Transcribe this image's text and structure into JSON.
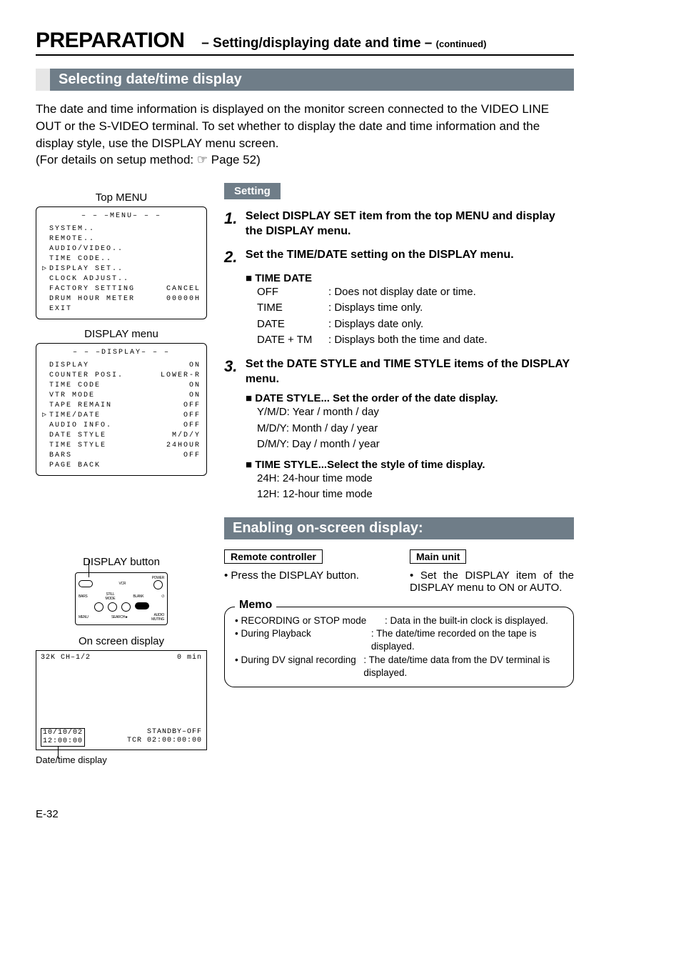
{
  "header": {
    "title": "PREPARATION",
    "subtitle": "– Setting/displaying date and time –",
    "continued": "(continued)"
  },
  "section1": {
    "title": "Selecting date/time display",
    "intro": "The date and time information is displayed on the monitor screen connected to the VIDEO LINE OUT or the S-VIDEO terminal. To set whether to display the date and time information and the display style, use the DISPLAY menu screen.",
    "intro_ref": "(For details on setup method: ☞ Page 52)"
  },
  "top_menu": {
    "label": "Top MENU",
    "heading": "– – –MENU– – –",
    "items": [
      {
        "caret": "",
        "name": "SYSTEM..",
        "val": ""
      },
      {
        "caret": "",
        "name": "REMOTE..",
        "val": ""
      },
      {
        "caret": "",
        "name": "AUDIO/VIDEO..",
        "val": ""
      },
      {
        "caret": "",
        "name": "TIME CODE..",
        "val": ""
      },
      {
        "caret": "▷",
        "name": "DISPLAY SET..",
        "val": ""
      },
      {
        "caret": "",
        "name": "CLOCK ADJUST..",
        "val": ""
      },
      {
        "caret": "",
        "name": "FACTORY SETTING",
        "val": "CANCEL"
      },
      {
        "caret": "",
        "name": "DRUM HOUR METER",
        "val": "00000H"
      },
      {
        "caret": "",
        "name": "EXIT",
        "val": ""
      }
    ]
  },
  "display_menu": {
    "label": "DISPLAY menu",
    "heading": "– – –DISPLAY– – –",
    "items": [
      {
        "caret": "",
        "name": "DISPLAY",
        "val": "ON"
      },
      {
        "caret": "",
        "name": "COUNTER POSI.",
        "val": "LOWER-R"
      },
      {
        "caret": "",
        "name": "TIME CODE",
        "val": "ON"
      },
      {
        "caret": "",
        "name": "VTR MODE",
        "val": "ON"
      },
      {
        "caret": "",
        "name": "TAPE REMAIN",
        "val": "OFF"
      },
      {
        "caret": "▷",
        "name": "TIME/DATE",
        "val": "OFF"
      },
      {
        "caret": "",
        "name": "AUDIO INFO.",
        "val": "OFF"
      },
      {
        "caret": "",
        "name": "DATE STYLE",
        "val": "M/D/Y"
      },
      {
        "caret": "",
        "name": "TIME STYLE",
        "val": "24HOUR"
      },
      {
        "caret": "",
        "name": "BARS",
        "val": "OFF"
      },
      {
        "caret": "",
        "name": "PAGE BACK",
        "val": ""
      }
    ]
  },
  "display_button_label": "DISPLAY button",
  "remote": {
    "display": "DISPLAY",
    "vcr": "VCR",
    "power": "POWER",
    "bars": "BARS",
    "still": "STILL\nMODE",
    "blank": "BLANK",
    "menu": "MENU",
    "search": "SEARCH►",
    "audio": "AUDIO\nMUTING"
  },
  "osd": {
    "label": "On screen display",
    "ch": "32K CH–1/2",
    "min": "0 min",
    "date": "10/10/02",
    "time": "12:00:00",
    "standby": "STANDBY–OFF",
    "tcr": "TCR 02:00:00:00",
    "caption": "Date/time display"
  },
  "setting": {
    "label": "Setting",
    "steps": {
      "s1": "Select DISPLAY SET item from the top MENU and display the DISPLAY menu.",
      "s2": "Set the TIME/DATE setting on the DISPLAY menu.",
      "s3": "Set the DATE STYLE and TIME STYLE items of the DISPLAY menu."
    },
    "time_date": {
      "title": "TIME DATE",
      "rows": [
        {
          "k": "OFF",
          "v": ": Does not display date or time."
        },
        {
          "k": "TIME",
          "v": ": Displays time only."
        },
        {
          "k": "DATE",
          "v": ": Displays date only."
        },
        {
          "k": "DATE + TM",
          "v": ": Displays both the time and date."
        }
      ]
    },
    "date_style": {
      "title": "DATE STYLE... Set the order of the date display.",
      "lines": [
        "Y/M/D: Year / month / day",
        "M/D/Y: Month / day / year",
        "D/M/Y: Day / month / year"
      ]
    },
    "time_style": {
      "title": "TIME STYLE...Select the style of time display.",
      "lines": [
        "24H: 24-hour time mode",
        "12H: 12-hour time mode"
      ]
    }
  },
  "enabling": {
    "title": "Enabling on-screen display:",
    "remote_label": "Remote controller",
    "remote_text": "• Press the DISPLAY button.",
    "main_label": "Main unit",
    "main_text": "• Set the DISPLAY item of the DISPLAY menu to ON or AUTO."
  },
  "memo": {
    "title": "Memo",
    "rows": [
      {
        "k": "• RECORDING or STOP mode",
        "v": ": Data in the built-in clock is displayed."
      },
      {
        "k": "• During Playback",
        "v": ": The date/time recorded on the tape is displayed."
      },
      {
        "k": "• During DV signal recording",
        "v": ": The date/time data from the DV terminal is displayed."
      }
    ]
  },
  "footer": "E-32"
}
